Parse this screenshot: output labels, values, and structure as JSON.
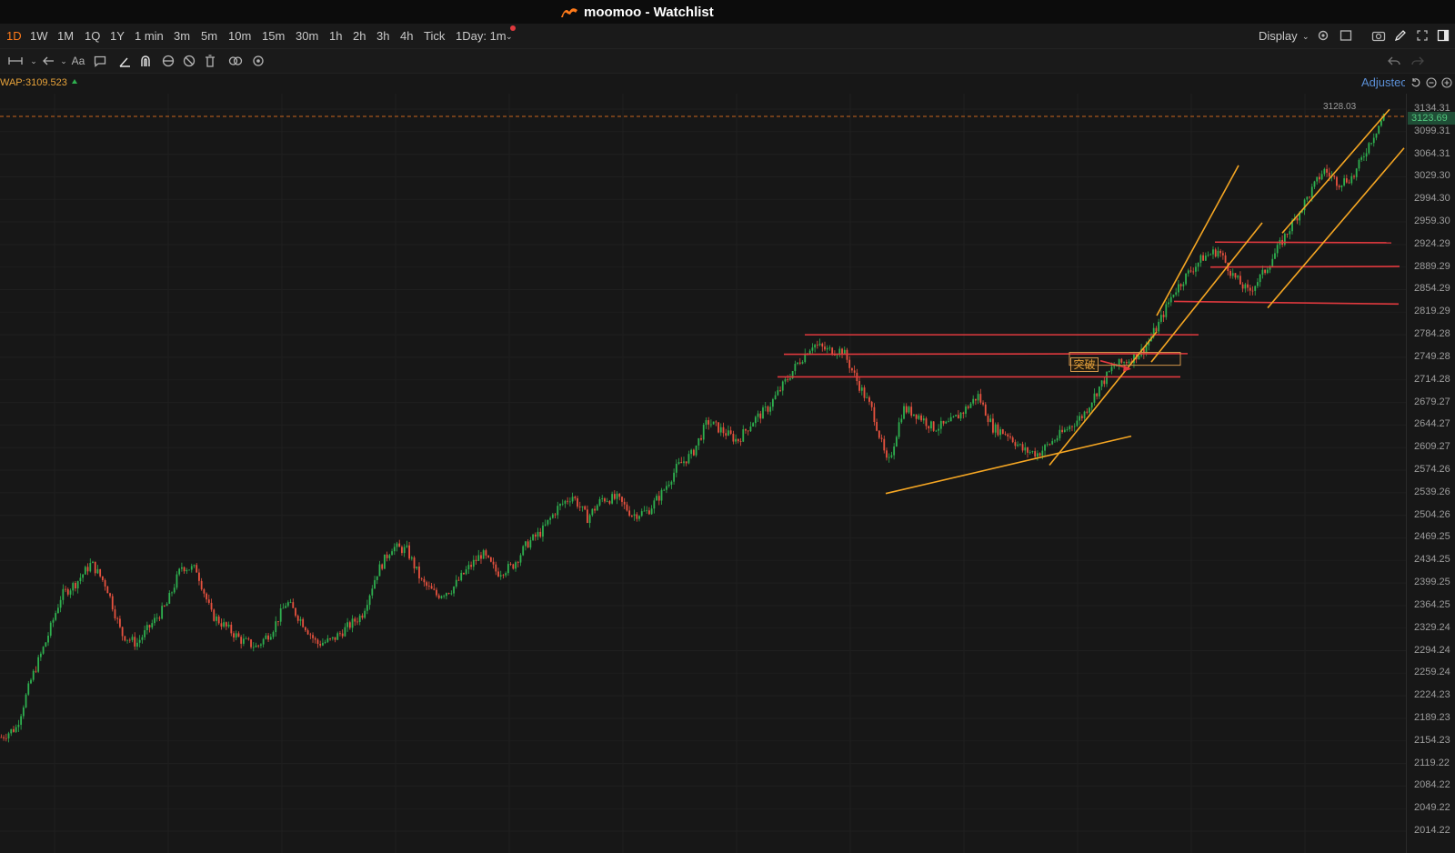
{
  "window": {
    "title": "moomoo - Watchlist",
    "brand_color": "#ff7a1a"
  },
  "timeframes": {
    "items": [
      "1D",
      "1W",
      "1M",
      "1Q",
      "1Y",
      "1 min",
      "3m",
      "5m",
      "10m",
      "15m",
      "30m",
      "1h",
      "2h",
      "3h",
      "4h",
      "Tick",
      "1Day: 1m"
    ],
    "active": "1D"
  },
  "toolbar_right": {
    "display_label": "Display"
  },
  "indicator": {
    "label": "WAP:",
    "value": "3109.523",
    "color": "#e8a33a"
  },
  "adjusted_label": "Adjustec",
  "annotation": {
    "text": "突破"
  },
  "price_axis": {
    "ticks": [
      "3134.31",
      "3099.31",
      "3064.31",
      "3029.30",
      "2994.30",
      "2959.30",
      "2924.29",
      "2889.29",
      "2854.29",
      "2819.29",
      "2784.28",
      "2749.28",
      "2714.28",
      "2679.27",
      "2644.27",
      "2609.27",
      "2574.26",
      "2539.26",
      "2504.26",
      "2469.25",
      "2434.25",
      "2399.25",
      "2364.25",
      "2329.24",
      "2294.24",
      "2259.24",
      "2224.23",
      "2189.23",
      "2154.23",
      "2119.22",
      "2084.22",
      "2049.22",
      "2014.22"
    ],
    "current_price": "3123.69",
    "high_label": "3128.03"
  },
  "colors": {
    "up": "#2eb04f",
    "down": "#e8523f",
    "support_line": "#e0393e",
    "trend_line": "#f5a623",
    "background": "#171717"
  },
  "chart_data": {
    "type": "candlestick",
    "ylim": [
      2014.22,
      3134.31
    ],
    "close_path": [
      2160,
      2175,
      2250,
      2310,
      2380,
      2400,
      2430,
      2395,
      2320,
      2305,
      2335,
      2365,
      2425,
      2420,
      2350,
      2330,
      2310,
      2300,
      2325,
      2370,
      2340,
      2305,
      2310,
      2330,
      2350,
      2415,
      2455,
      2450,
      2400,
      2380,
      2390,
      2420,
      2445,
      2415,
      2425,
      2460,
      2480,
      2515,
      2535,
      2500,
      2530,
      2530,
      2505,
      2510,
      2540,
      2580,
      2600,
      2650,
      2635,
      2620,
      2650,
      2670,
      2705,
      2740,
      2770,
      2760,
      2760,
      2710,
      2665,
      2580,
      2670,
      2660,
      2640,
      2645,
      2665,
      2690,
      2640,
      2630,
      2605,
      2600,
      2620,
      2640,
      2660,
      2700,
      2735,
      2745,
      2760,
      2800,
      2850,
      2880,
      2905,
      2915,
      2875,
      2850,
      2880,
      2920,
      2960,
      3000,
      3040,
      3020,
      3030,
      3080,
      3123.69
    ],
    "horizontal_levels": [
      2784.28,
      2754,
      2719,
      2928,
      2889.29,
      2836
    ],
    "channels": [
      {
        "from_price": 2538,
        "to_price": 2627
      },
      {
        "from_price": 2582,
        "to_price": 2789
      }
    ]
  }
}
